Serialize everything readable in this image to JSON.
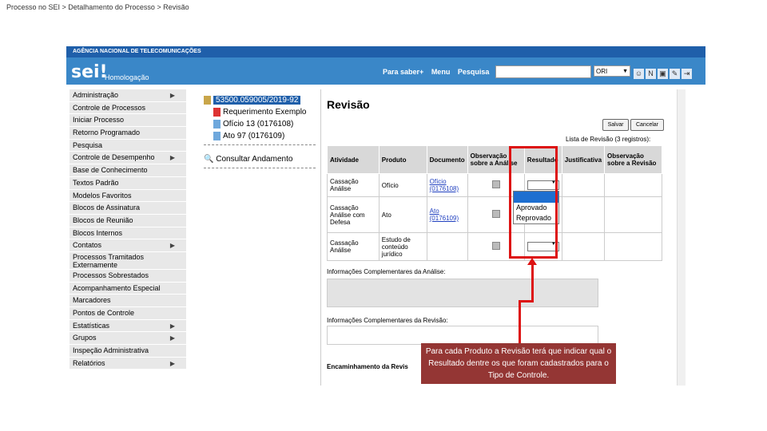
{
  "breadcrumb": "Processo no SEI > Detalhamento do Processo > Revisão",
  "header": {
    "agency": "AGÊNCIA NACIONAL DE TELECOMUNICAÇÕES",
    "logo": "sei!",
    "environment": "Homologação",
    "links": [
      "Para saber+",
      "Menu",
      "Pesquisa"
    ],
    "search_value": "",
    "unit": "ORI",
    "icons": [
      "person-icon",
      "notes-icon",
      "window-icon",
      "tools-icon",
      "exit-icon"
    ]
  },
  "menu": [
    {
      "label": "Administração",
      "sub": true
    },
    {
      "label": "Controle de Processos",
      "sub": false
    },
    {
      "label": "Iniciar Processo",
      "sub": false
    },
    {
      "label": "Retorno Programado",
      "sub": false
    },
    {
      "label": "Pesquisa",
      "sub": false
    },
    {
      "label": "Controle de Desempenho",
      "sub": true
    },
    {
      "label": "Base de Conhecimento",
      "sub": false
    },
    {
      "label": "Textos Padrão",
      "sub": false
    },
    {
      "label": "Modelos Favoritos",
      "sub": false
    },
    {
      "label": "Blocos de Assinatura",
      "sub": false
    },
    {
      "label": "Blocos de Reunião",
      "sub": false
    },
    {
      "label": "Blocos Internos",
      "sub": false
    },
    {
      "label": "Contatos",
      "sub": true
    },
    {
      "label": "Processos Tramitados Externamente",
      "sub": false
    },
    {
      "label": "Processos Sobrestados",
      "sub": false
    },
    {
      "label": "Acompanhamento Especial",
      "sub": false
    },
    {
      "label": "Marcadores",
      "sub": false
    },
    {
      "label": "Pontos de Controle",
      "sub": false
    },
    {
      "label": "Estatísticas",
      "sub": true
    },
    {
      "label": "Grupos",
      "sub": true
    },
    {
      "label": "Inspeção Administrativa",
      "sub": false
    },
    {
      "label": "Relatórios",
      "sub": true
    }
  ],
  "tree": {
    "process": "53500.059005/2019-92",
    "docs": [
      "Requerimento Exemplo",
      "Ofício 13 (0176108)",
      "Ato 97 (0176109)"
    ],
    "consult": "Consultar Andamento"
  },
  "review": {
    "title": "Revisão",
    "save": "Salvar",
    "cancel": "Cancelar",
    "list_caption": "Lista de Revisão (3 registros):",
    "headers": [
      "Atividade",
      "Produto",
      "Documento",
      "Observação sobre a Análise",
      "Resultado",
      "Justificativa",
      "Observação sobre a Revisão"
    ],
    "rows": [
      {
        "atividade": "Cassação Análise",
        "produto": "Ofício",
        "doc_name": "Ofício",
        "doc_num": "(0176108)"
      },
      {
        "atividade": "Cassação Análise com Defesa",
        "produto": "Ato",
        "doc_name": "Ato",
        "doc_num": "(0176109)"
      },
      {
        "atividade": "Cassação Análise",
        "produto": "Estudo de conteúdo jurídico",
        "doc_name": "",
        "doc_num": ""
      }
    ],
    "dropdown_options": [
      "Aprovado",
      "Reprovado"
    ],
    "info_analise_label": "Informações Complementares da Análise:",
    "info_revisao_label": "Informações Complementares da Revisão:",
    "encaminhamento_label": "Encaminhamento da Revis"
  },
  "callout": "Para cada Produto a Revisão terá que indicar qual o Resultado dentre os que foram cadastrados para o Tipo de Controle.",
  "colors": {
    "accent": "#3a87c8",
    "highlight": "#dd1111",
    "callout_bg": "#943634"
  }
}
